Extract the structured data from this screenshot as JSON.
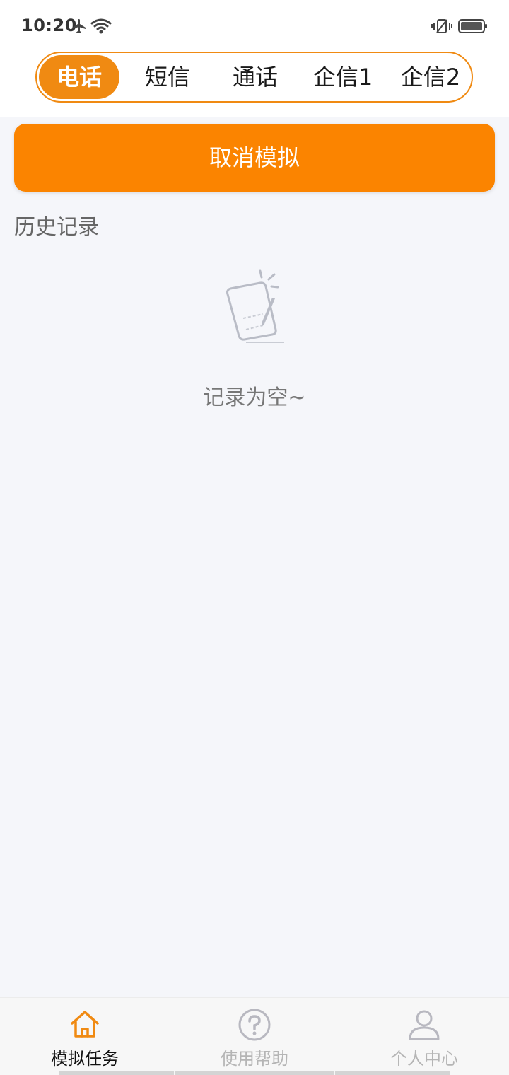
{
  "status": {
    "time": "10:20"
  },
  "tabs": [
    {
      "label": "电话",
      "active": true
    },
    {
      "label": "短信",
      "active": false
    },
    {
      "label": "通话",
      "active": false
    },
    {
      "label": "企信1",
      "active": false
    },
    {
      "label": "企信2",
      "active": false
    }
  ],
  "main": {
    "cancel_label": "取消模拟",
    "history_title": "历史记录",
    "empty_text": "记录为空~"
  },
  "bottom_nav": [
    {
      "label": "模拟任务",
      "icon": "home-icon",
      "active": true
    },
    {
      "label": "使用帮助",
      "icon": "help-icon",
      "active": false
    },
    {
      "label": "个人中心",
      "icon": "user-icon",
      "active": false
    }
  ],
  "colors": {
    "accent": "#fb8400",
    "tab_accent": "#f08a12",
    "background": "#f5f6fa"
  }
}
